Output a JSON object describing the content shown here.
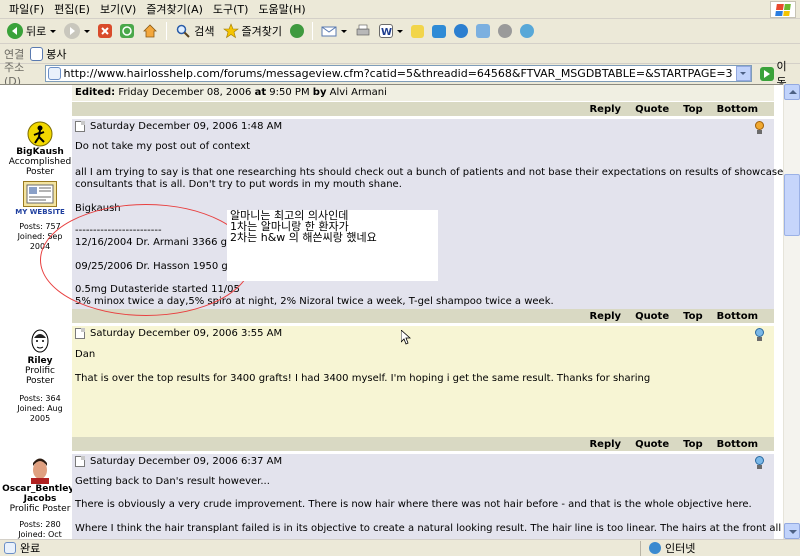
{
  "menu": [
    "파일(F)",
    "편집(E)",
    "보기(V)",
    "즐겨찾기(A)",
    "도구(T)",
    "도움말(H)"
  ],
  "toolbar": {
    "back_label": "뒤로",
    "search_label": "검색",
    "favorites_label": "즐겨찾기"
  },
  "links": {
    "connect_label": "연결",
    "bongsa_label": "봉사"
  },
  "address": {
    "label": "주소(D)",
    "url": "http://www.hairlosshelp.com/forums/messageview.cfm?catid=5&threadid=64568&FTVAR_MSGDBTABLE=&STARTPAGE=3",
    "go_label": "이동"
  },
  "edited": {
    "prefix": "Edited:",
    "date": "Friday December 08, 2006",
    "at": "at",
    "time": "9:50 PM",
    "by": "by",
    "author": "Alvi Armani"
  },
  "actions": [
    "Reply",
    "Quote",
    "Top",
    "Bottom"
  ],
  "posts": [
    {
      "username": "BigKaush",
      "title": "Accomplished Poster",
      "website": "MY WEBSITE",
      "stats": "Posts: 757 Joined: Sep 2004",
      "date": "Saturday December 09, 2006 1:48 AM",
      "lines": [
        "Do not take my post out of context",
        "all I am trying to say is that one researching hts should check out a bunch of patients and not base their expectations on results of showcase patients or planned",
        "consultants that is all. Don't try to put words in my mouth shane.",
        "Bigkaush",
        "------------------------",
        "12/16/2004 Dr. Armani 3366 grafts",
        "09/25/2006 Dr. Hasson 1950 grafts",
        "0.5mg Dutasteride started 11/05",
        "5% minox twice a day,5% spiro at night, 2% Nizoral twice a week, T-gel shampoo twice a week."
      ]
    },
    {
      "username": "Riley",
      "title": "Prolific Poster",
      "stats": "Posts: 364 Joined: Aug 2005",
      "date": "Saturday December 09, 2006 3:55 AM",
      "lines": [
        "Dan",
        "That is over the top results for 3400 grafts! I had 3400 myself. I'm hoping i get the same result. Thanks for sharing"
      ]
    },
    {
      "username": "Oscar_Bentley-Jacobs",
      "title": "Prolific Poster",
      "stats": "Posts: 280 Joined: Oct 2006",
      "date": "Saturday December 09, 2006 6:37 AM",
      "lines": [
        "Getting back to Dan's result however...",
        "There is obviously a very crude improvement. There is now hair where there was not hair before - and that is the whole objective here.",
        "Where I think the hair transplant failed is in its objective to create a natural looking result. The hair line is too linear. The hairs at the front all stand up like a row of"
      ]
    }
  ],
  "annotation": {
    "lines": [
      "알마니는 최고의 의사인데",
      "1차는 알마니랑 한 환자가",
      "2차는 h&w 의 해쓴씨랑 했네요"
    ]
  },
  "status": {
    "left": "완료",
    "right": "인터넷"
  },
  "colors": {
    "post_bg_grey": "#e3e3ed",
    "post_bg_yellow": "#f7f5d4",
    "action_bar": "#d9d9c3",
    "annotation_circle": "#e84040"
  }
}
